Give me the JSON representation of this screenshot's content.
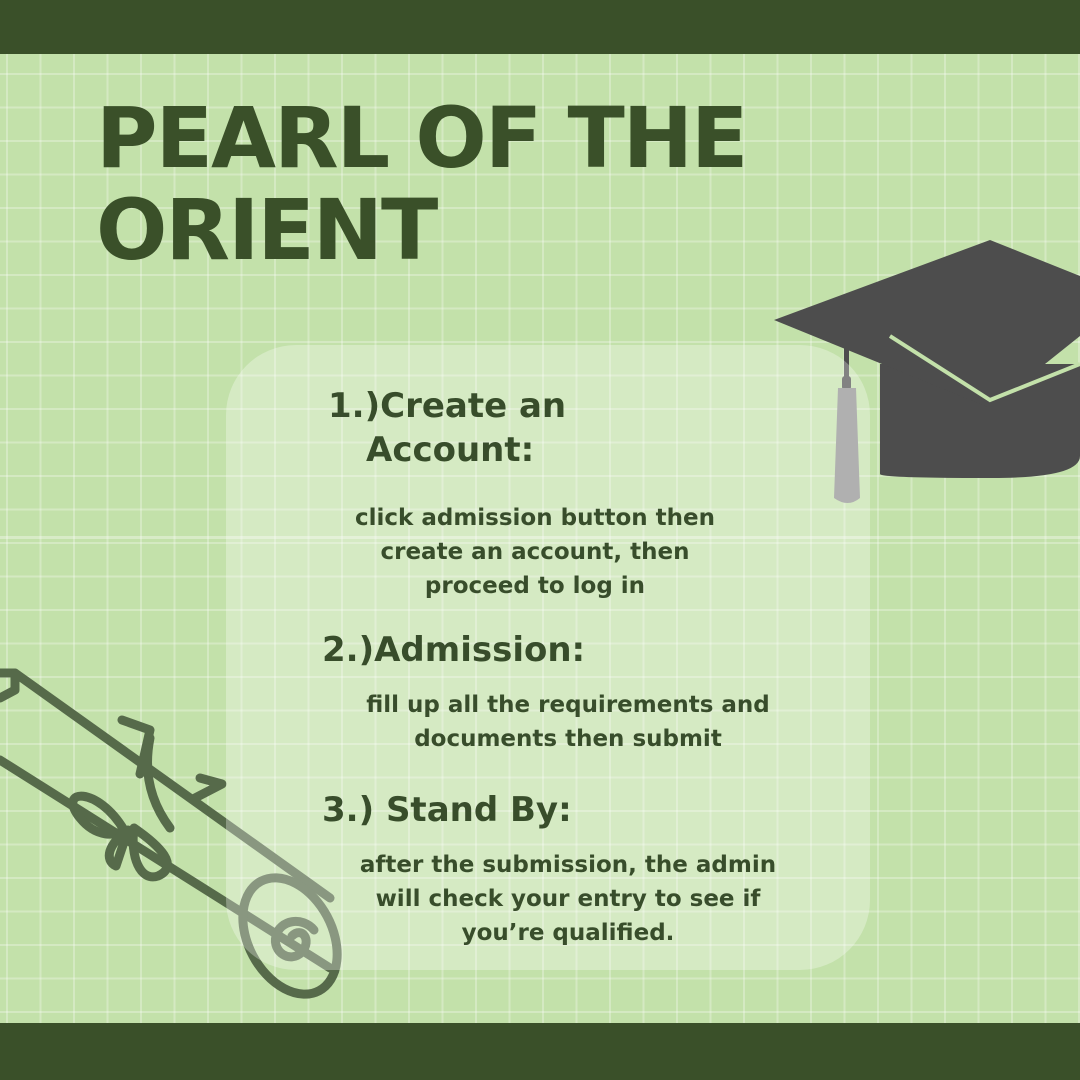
{
  "title": {
    "line1": "PEARL OF THE",
    "line2": "ORIENT"
  },
  "steps": [
    {
      "heading_line1": "1.)Create an",
      "heading_line2": "Account:",
      "body_lines": [
        "click admission button then",
        "create an account, then",
        "proceed to log in"
      ]
    },
    {
      "heading": "2.)Admission:",
      "body_lines": [
        "fill up all the requirements and",
        "documents then submit"
      ]
    },
    {
      "heading": "3.) Stand By:",
      "body_lines": [
        "after the submission, the admin",
        "will check your entry to see if",
        "you’re qualified."
      ]
    }
  ],
  "colors": {
    "background": "#c3e1aa",
    "band": "#3a5029",
    "text": "#384d2b",
    "cap": "#4d4d4d",
    "scroll_outline": "#566a4a"
  },
  "icons": {
    "cap": "graduation-cap-icon",
    "diploma": "diploma-scroll-icon"
  }
}
